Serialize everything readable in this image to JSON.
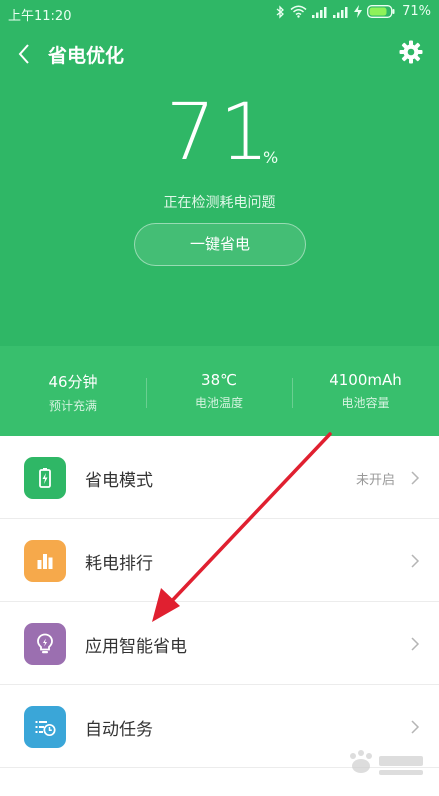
{
  "status_bar": {
    "time": "上午11:20",
    "battery_percent": "71%",
    "icons": [
      "bluetooth-icon",
      "wifi-icon",
      "signal-icon",
      "signal-icon",
      "charging-icon",
      "battery-icon"
    ]
  },
  "header": {
    "title": "省电优化",
    "back_icon": "back-arrow-icon",
    "settings_icon": "gear-icon"
  },
  "battery": {
    "level": "71",
    "unit": "%",
    "status": "正在检测耗电问题",
    "optimize_button": "一键省电"
  },
  "stats": [
    {
      "value": "46分钟",
      "label": "预计充满"
    },
    {
      "value": "38℃",
      "label": "电池温度"
    },
    {
      "value": "4100mAh",
      "label": "电池容量"
    }
  ],
  "menu": [
    {
      "label": "省电模式",
      "status": "未开启",
      "icon": "battery-mode-icon",
      "color": "#2fb766"
    },
    {
      "label": "耗电排行",
      "status": "",
      "icon": "bar-chart-icon",
      "color": "#f6a94b"
    },
    {
      "label": "应用智能省电",
      "status": "",
      "icon": "lightbulb-icon",
      "color": "#9b6fb0"
    },
    {
      "label": "自动任务",
      "status": "",
      "icon": "scheduled-task-icon",
      "color": "#3aa6d8"
    }
  ],
  "colors": {
    "hero_green": "#2fb766",
    "stats_green": "#38bf6d",
    "annotation_arrow": "#e02030"
  }
}
